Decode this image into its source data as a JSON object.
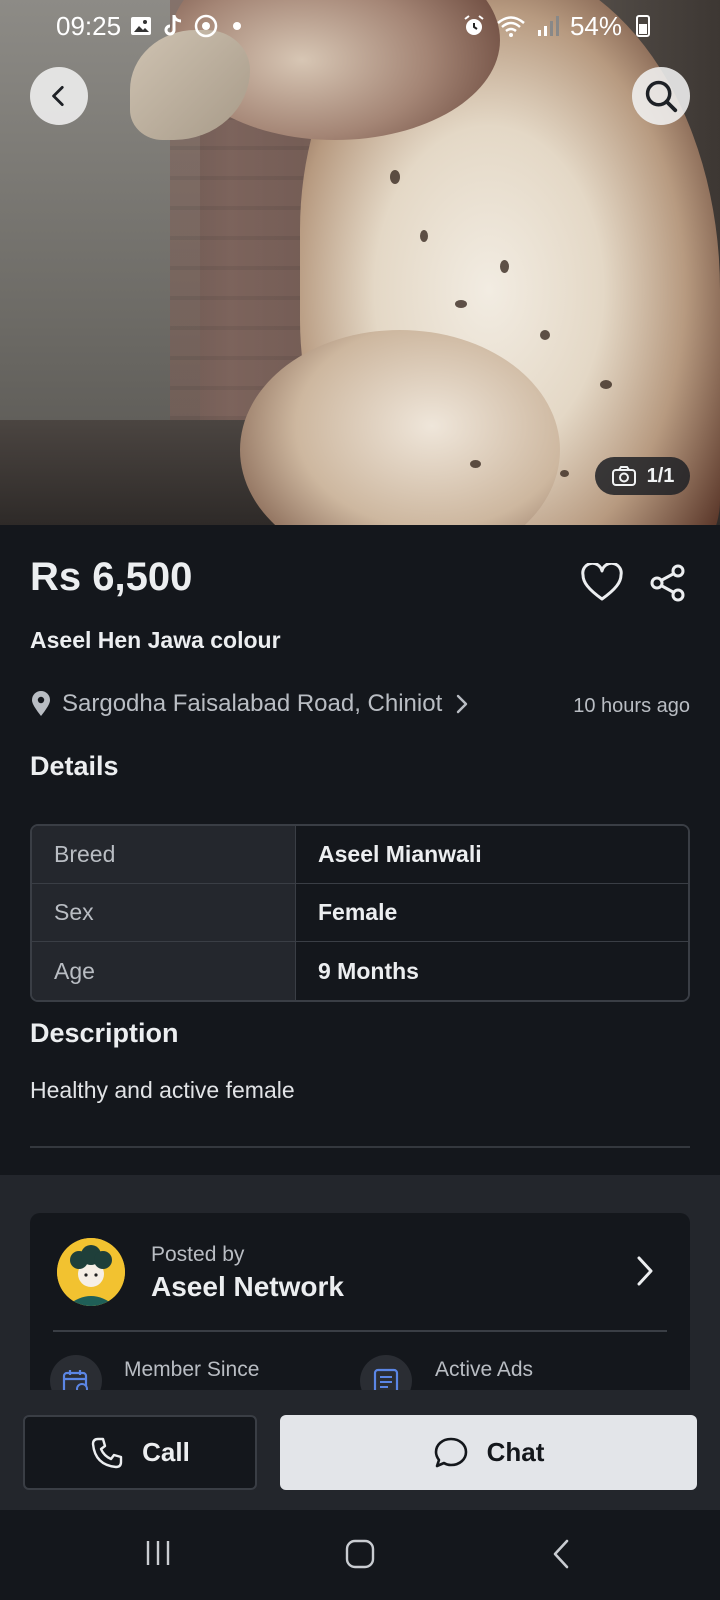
{
  "status_bar": {
    "time": "09:25",
    "notification_icons": [
      "gallery-icon",
      "tiktok-icon",
      "screen-recorder-icon",
      "dot-icon"
    ],
    "system_icons": [
      "alarm-icon",
      "wifi-icon",
      "signal-icon",
      "battery-icon"
    ],
    "battery": "54%",
    "battery_level": 0.54
  },
  "photo": {
    "counter": "1/1"
  },
  "listing": {
    "price": "Rs 6,500",
    "title": "Aseel Hen Jawa colour",
    "location": "Sargodha Faisalabad Road, Chiniot",
    "posted_time": "10 hours ago"
  },
  "details": {
    "heading": "Details",
    "rows": [
      {
        "key": "Breed",
        "value": "Aseel Mianwali"
      },
      {
        "key": "Sex",
        "value": "Female"
      },
      {
        "key": "Age",
        "value": "9 Months"
      }
    ]
  },
  "description": {
    "heading": "Description",
    "text": "Healthy and active female"
  },
  "seller": {
    "posted_by_label": "Posted by",
    "name": "Aseel Network",
    "member_since_label": "Member Since",
    "active_ads_label": "Active Ads"
  },
  "actions": {
    "call_label": "Call",
    "chat_label": "Chat"
  },
  "colors": {
    "background": "#14171c",
    "surface": "#23262c",
    "text_primary": "#eceef0",
    "text_secondary": "#b9bdc3",
    "chat_button": "#e3e5e9"
  }
}
